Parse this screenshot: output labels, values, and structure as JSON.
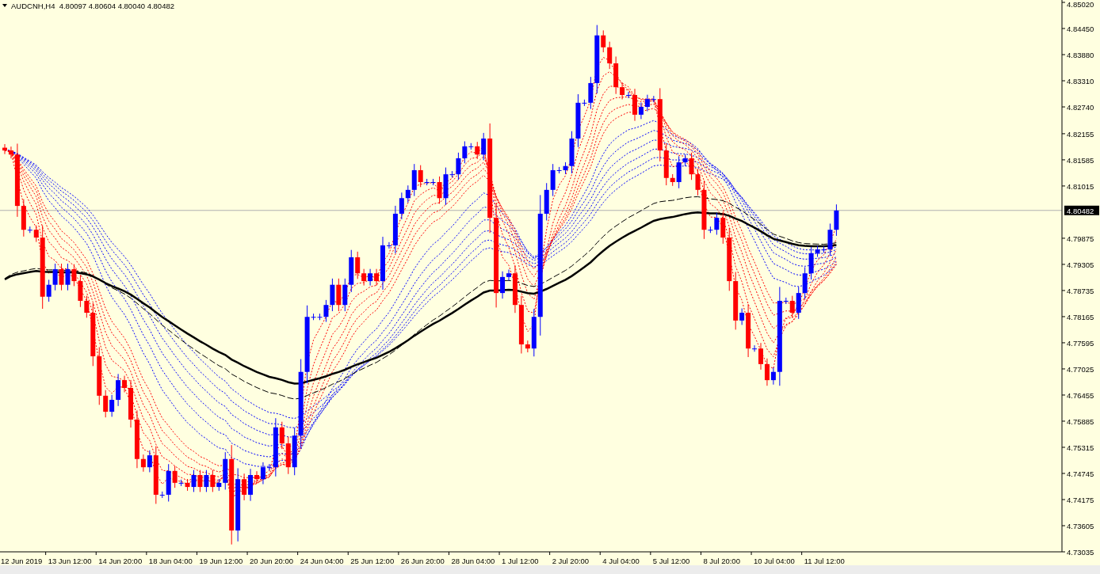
{
  "chart": {
    "title": "AUDCNH,H4  4.80097 4.80604 4.80040 4.80482",
    "price_axis": [
      "4.85020",
      "4.84450",
      "4.83880",
      "4.83310",
      "4.82740",
      "4.82155",
      "4.81585",
      "4.81015",
      "4.79875",
      "4.79305",
      "4.78735",
      "4.78165",
      "4.77595",
      "4.77025",
      "4.76455",
      "4.75885",
      "4.75315",
      "4.74745",
      "4.74175",
      "4.73605",
      "4.73035"
    ],
    "current_price": "4.80482",
    "time_axis": [
      "12 Jun 2019",
      "13 Jun 12:00",
      "14 Jun 20:00",
      "18 Jun 04:00",
      "19 Jun 12:00",
      "20 Jun 20:00",
      "24 Jun 04:00",
      "25 Jun 12:00",
      "26 Jun 20:00",
      "28 Jun 04:00",
      "1 Jul 12:00",
      "2 Jul 20:00",
      "4 Jul 04:00",
      "5 Jul 12:00",
      "8 Jul 20:00",
      "10 Jul 04:00",
      "11 Jul 12:00"
    ]
  }
}
